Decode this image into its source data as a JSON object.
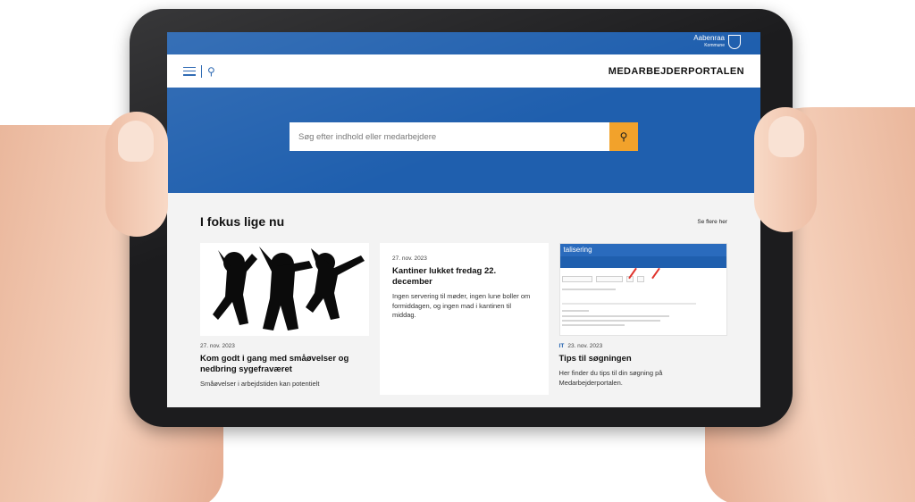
{
  "topbar": {
    "logo_name": "Aabenraa",
    "logo_sub": "Kommune"
  },
  "header": {
    "title": "MEDARBEJDERPORTALEN",
    "menu_icon": "hamburger-icon",
    "search_icon": "magnifier-icon"
  },
  "hero": {
    "search_placeholder": "Søg efter indhold eller medarbejdere",
    "search_button_icon": "magnifier-icon"
  },
  "focus": {
    "title": "I fokus lige nu",
    "see_more": "Se flere her",
    "cards": [
      {
        "date": "27. nov. 2023",
        "title": "Kom godt i gang med småøvelser og nedbring sygefraværet",
        "text": "Småøvelser i arbejdstiden kan potentielt"
      },
      {
        "date": "27. nov. 2023",
        "title": "Kantiner lukket fredag 22. december",
        "text": "Ingen servering til møder, ingen lune boller om formiddagen, og ingen mad i kantinen til middag."
      },
      {
        "tag": "IT",
        "date": "23. nov. 2023",
        "title": "Tips til søgningen",
        "text": "Her finder du tips til din søgning på Medarbejderportalen.",
        "thumb_heading": "talisering"
      }
    ]
  },
  "colors": {
    "brand_blue": "#1f5fae",
    "accent_orange": "#f2a22b"
  }
}
